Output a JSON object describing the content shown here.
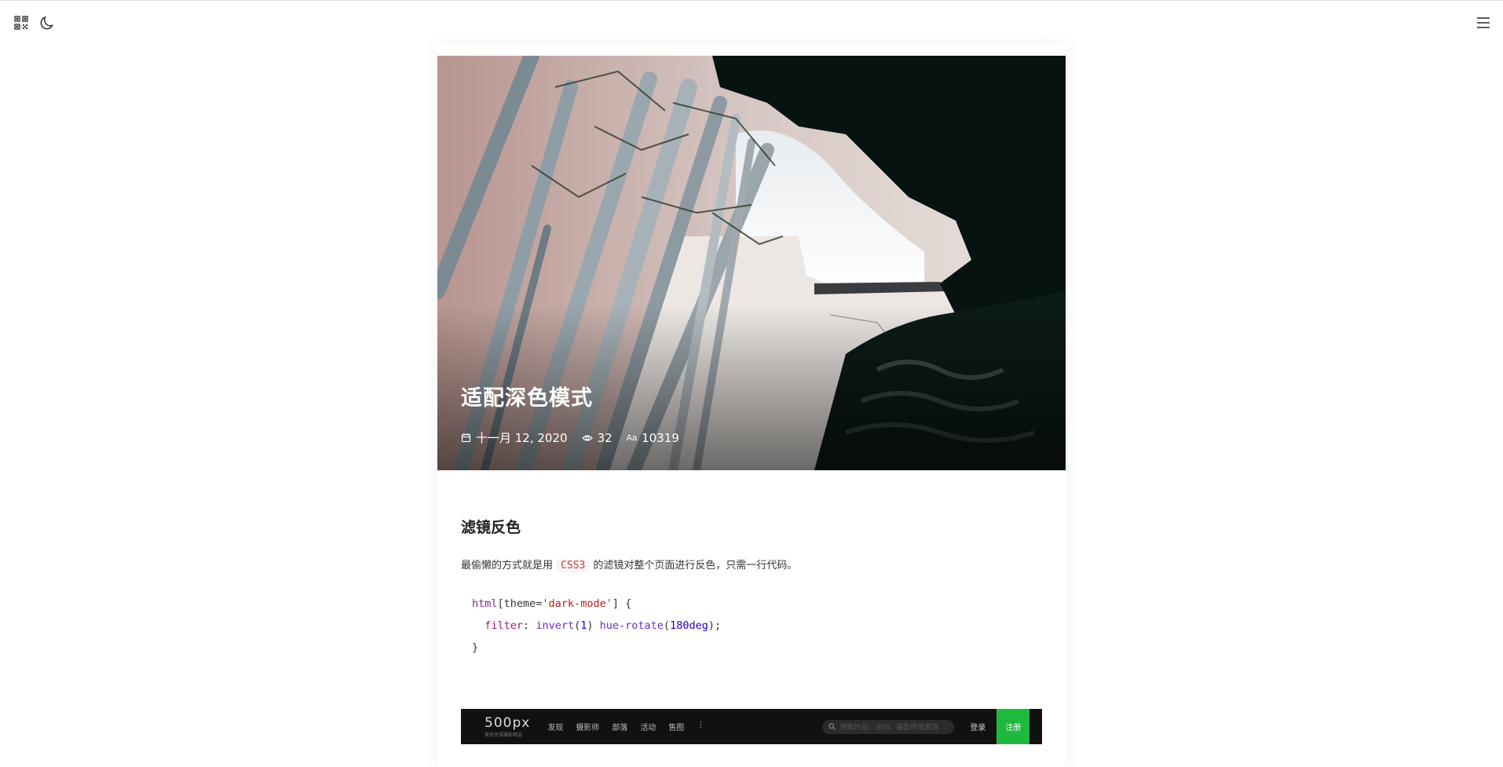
{
  "topbar": {
    "qrcode_icon": "qrcode-icon",
    "theme_icon": "moon-icon",
    "menu_icon": "hamburger-menu-icon"
  },
  "post": {
    "title": "适配深色模式",
    "date": "十一月 12, 2020",
    "views": "32",
    "words": "10319"
  },
  "content": {
    "heading": "滤镜反色",
    "para_before": "最偷懒的方式就是用",
    "para_code": "CSS3",
    "para_after": "的滤镜对整个页面进行反色，只需一行代码。",
    "code": {
      "tag": "html",
      "selector_open": "[theme=",
      "selector_value": "'dark-mode'",
      "selector_close": "] {",
      "prop": "filter",
      "colon": ": ",
      "fn1": "invert",
      "arg1": "1",
      "fn2": "hue-rotate",
      "arg2": "180deg",
      "end": ");",
      "close": "}"
    }
  },
  "preview": {
    "logo": "500px",
    "logo_sub": "发现幸福摄影精选",
    "nav": [
      "发现",
      "摄影师",
      "部落",
      "活动",
      "售图",
      "⋮"
    ],
    "search_placeholder": "搜索作品、活动、摄影师或部落",
    "login": "登录",
    "register": "注册"
  },
  "colors": {
    "accent_code": "#d9363e",
    "register_green": "#1eb93f"
  }
}
